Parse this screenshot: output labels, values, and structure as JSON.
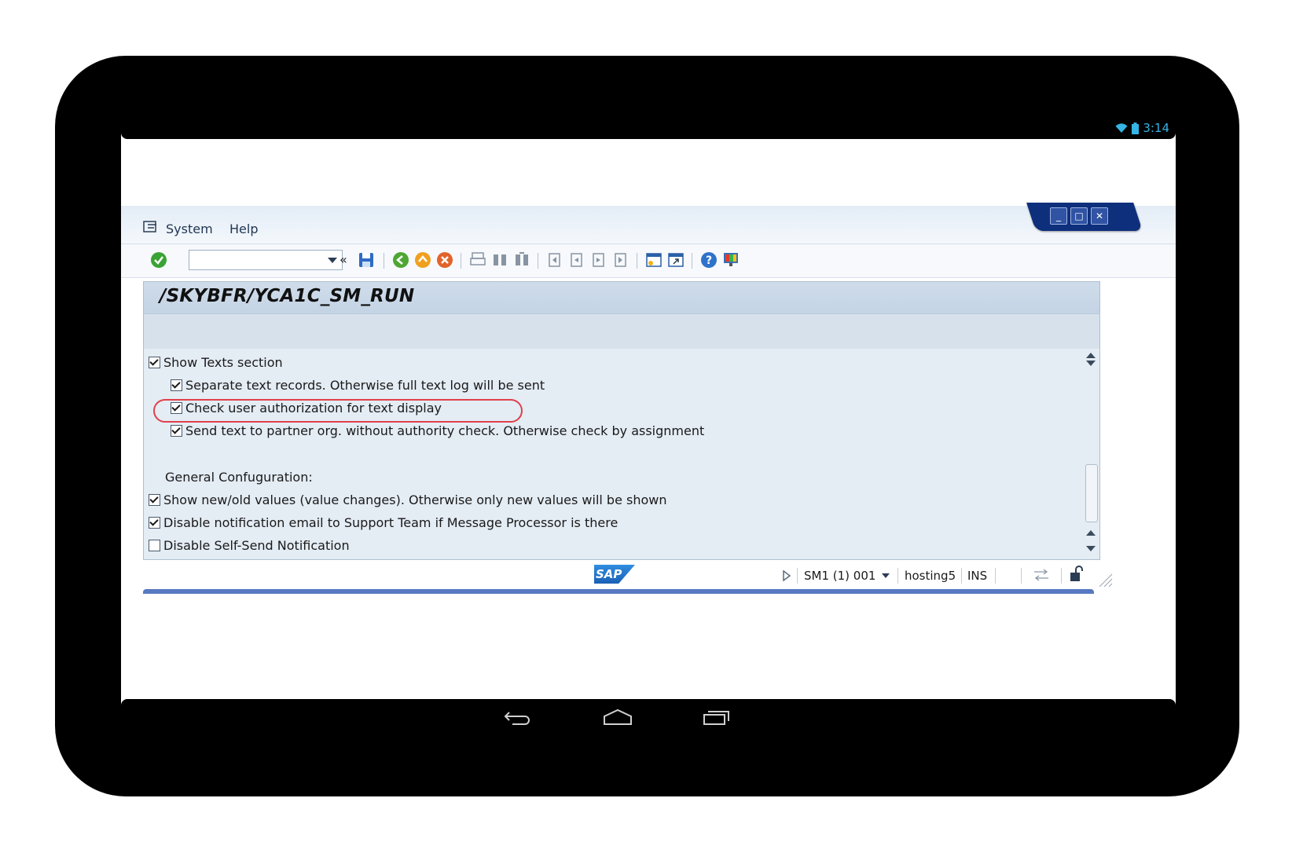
{
  "device": {
    "clock": "3:14"
  },
  "menu": {
    "items": [
      "System",
      "Help"
    ]
  },
  "toolbar": {
    "command_value": "",
    "icons": [
      "enter-icon",
      "save-icon",
      "back-icon",
      "exit-icon",
      "cancel-icon",
      "print-icon",
      "find-icon",
      "find-next-icon",
      "first-page-icon",
      "previous-page-icon",
      "next-page-icon",
      "last-page-icon",
      "new-session-icon",
      "shortcut-icon",
      "help-icon",
      "customize-layout-icon"
    ]
  },
  "screen": {
    "title": "/SKYBFR/YCA1C_SM_RUN",
    "options": [
      {
        "label": "Show Texts section",
        "checked": true
      },
      {
        "label": "Separate text records. Otherwise full text log will be sent",
        "checked": true
      },
      {
        "label": "Check user authorization for text display",
        "checked": true
      },
      {
        "label": "Send text to partner org. without authority check. Otherwise check by assignment",
        "checked": true
      }
    ],
    "section_label": "General Confuguration:",
    "general_options": [
      {
        "label": "Show new/old values (value changes). Otherwise only new values will be shown",
        "checked": true
      },
      {
        "label": "Disable notification email to Support Team if Message Processor is there",
        "checked": true
      },
      {
        "label": "Disable Self-Send Notification",
        "checked": false
      }
    ]
  },
  "status": {
    "logo": "SAP",
    "system": "SM1 (1) 001",
    "server": "hosting5",
    "mode": "INS"
  },
  "colors": {
    "highlight": "#e0404a",
    "window_blue": "#0e2f7c",
    "android_blue": "#35b5e5"
  }
}
